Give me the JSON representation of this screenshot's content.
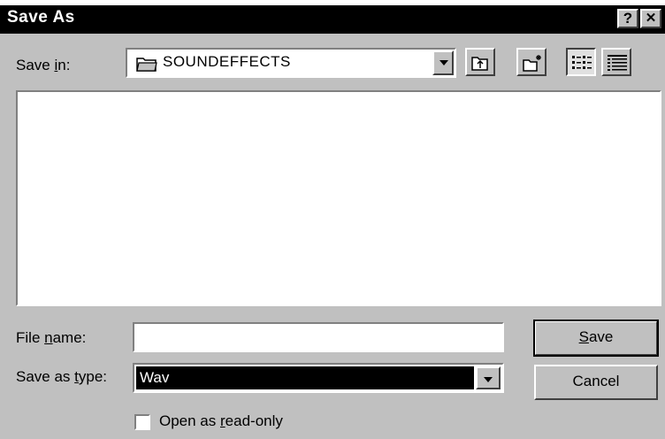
{
  "window": {
    "title": "Save As",
    "help_button": "?",
    "close_button": "✕"
  },
  "look_in": {
    "label_pre": "Save ",
    "label_u": "i",
    "label_post": "n:",
    "value": "SOUNDEFFECTS",
    "icon": "folder-icon"
  },
  "toolbar": {
    "buttons": [
      "up-one-level-icon",
      "create-new-folder-icon",
      "list-view-icon",
      "details-view-icon"
    ]
  },
  "file_name": {
    "label_pre": "File ",
    "label_u": "n",
    "label_post": "ame:",
    "value": ""
  },
  "save_type": {
    "label_pre": "Save as ",
    "label_u": "t",
    "label_post": "ype:",
    "value": "Wav"
  },
  "buttons": {
    "save_u": "S",
    "save_rest": "ave",
    "cancel": "Cancel"
  },
  "read_only": {
    "label_pre": "Open as ",
    "label_u": "r",
    "label_post": "ead-only",
    "checked": false
  }
}
